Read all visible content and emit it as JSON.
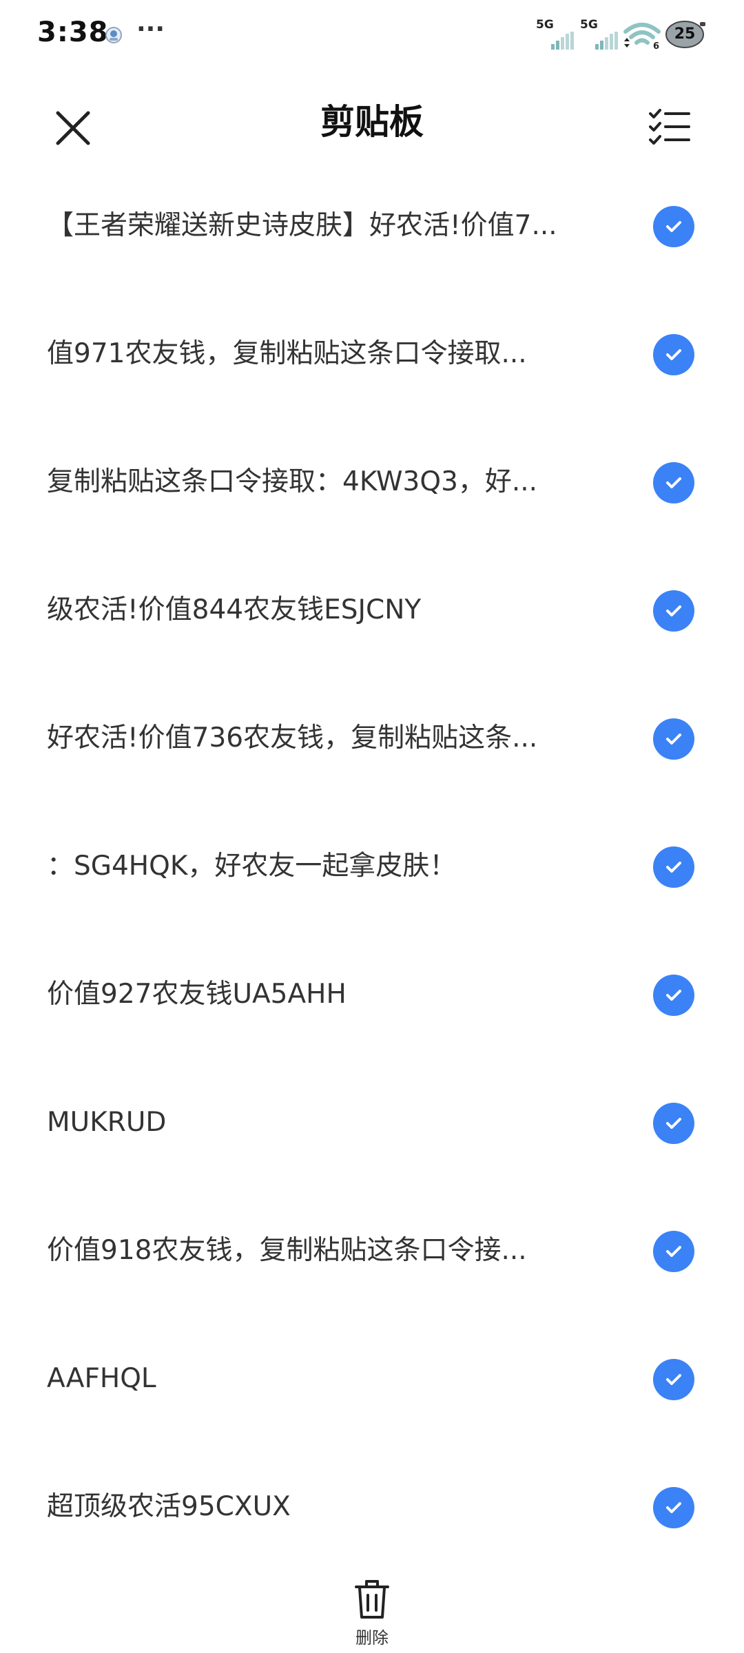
{
  "status_bar": {
    "time": "3:38",
    "dots": "···",
    "signal1_label": "5G",
    "signal2_label": "5G",
    "battery_level": "25",
    "icons": [
      "notification-app-icon",
      "signal-icon",
      "signal-icon",
      "wifi-icon",
      "battery-icon"
    ]
  },
  "header": {
    "title": "剪贴板",
    "left_icon": "close-icon",
    "right_icon": "multi-select-list-icon"
  },
  "clipboard": {
    "items": [
      {
        "text": "【王者荣耀送新史诗皮肤】好农活!价值7...",
        "checked": true
      },
      {
        "text": "值971农友钱，复制粘贴这条口令接取...",
        "checked": true
      },
      {
        "text": "复制粘贴这条口令接取：4KW3Q3，好...",
        "checked": true
      },
      {
        "text": "级农活!价值844农友钱ESJCNY",
        "checked": true
      },
      {
        "text": "好农活!价值736农友钱，复制粘贴这条...",
        "checked": true
      },
      {
        "text": "：SG4HQK，好农友一起拿皮肤！",
        "checked": true
      },
      {
        "text": "价值927农友钱UA5AHH",
        "checked": true
      },
      {
        "text": "MUKRUD",
        "checked": true
      },
      {
        "text": "价值918农友钱，复制粘贴这条口令接...",
        "checked": true
      },
      {
        "text": "AAFHQL",
        "checked": true
      },
      {
        "text": "超顶级农活95CXUX",
        "checked": true
      }
    ]
  },
  "bottom_bar": {
    "delete_label": "删除",
    "delete_icon": "trash-icon"
  },
  "colors": {
    "accent": "#3b82f6",
    "text": "#333333",
    "background": "#ffffff"
  }
}
